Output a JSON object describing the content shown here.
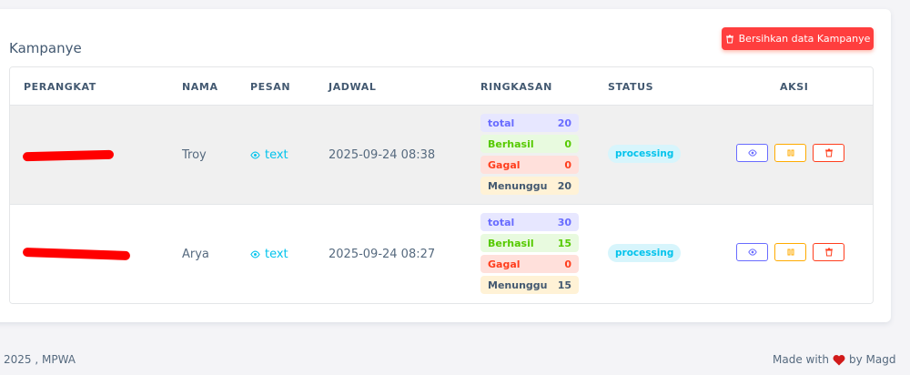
{
  "card": {
    "title": "Kampanye",
    "clear_button_label": "Bersihkan data Kampanye"
  },
  "table": {
    "headers": [
      "PERANGKAT",
      "NAMA",
      "PESAN",
      "JADWAL",
      "RINGKASAN",
      "STATUS",
      "AKSI"
    ],
    "rows": [
      {
        "device": "[redacted]",
        "name": "Troy",
        "message_link": "text",
        "schedule": "2025-09-24 08:38",
        "summary": {
          "total_label": "total",
          "total": "20",
          "success_label": "Berhasil",
          "success": "0",
          "failed_label": "Gagal",
          "failed": "0",
          "waiting_label": "Menunggu",
          "waiting": "20"
        },
        "status": "processing"
      },
      {
        "device": "[redacted]",
        "name": "Arya",
        "message_link": "text",
        "schedule": "2025-09-24 08:27",
        "summary": {
          "total_label": "total",
          "total": "30",
          "success_label": "Berhasil",
          "success": "15",
          "failed_label": "Gagal",
          "failed": "0",
          "waiting_label": "Menunggu",
          "waiting": "15"
        },
        "status": "processing"
      }
    ],
    "action_icons": [
      "eye-icon",
      "pause-icon",
      "trash-icon"
    ]
  },
  "footer": {
    "copyright": "2025 , MPWA",
    "made_with": "Made with",
    "by": "by Magd"
  },
  "colors": {
    "danger": "#ff3e3e",
    "primary": "#696cff",
    "success": "#56ca00",
    "warning": "#ffab00",
    "info": "#03c3ec"
  }
}
